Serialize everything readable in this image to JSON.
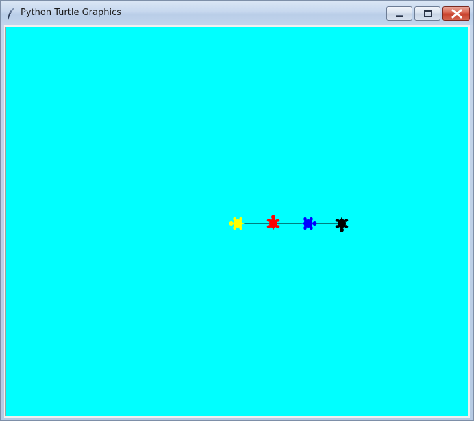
{
  "window": {
    "title": "Python Turtle Graphics",
    "app_icon": "feather-icon",
    "controls": {
      "minimize": "minimize-icon",
      "maximize": "maximize-icon",
      "close": "close-icon"
    }
  },
  "canvas": {
    "background_color": "#00ffff",
    "line_color": "#000000",
    "turtles": [
      {
        "name": "yellow-turtle",
        "color": "#ffff00",
        "heading": "west"
      },
      {
        "name": "red-turtle",
        "color": "#ff0000",
        "heading": "north"
      },
      {
        "name": "blue-turtle",
        "color": "#0000ff",
        "heading": "east"
      },
      {
        "name": "black-turtle",
        "color": "#000000",
        "heading": "south"
      }
    ]
  }
}
